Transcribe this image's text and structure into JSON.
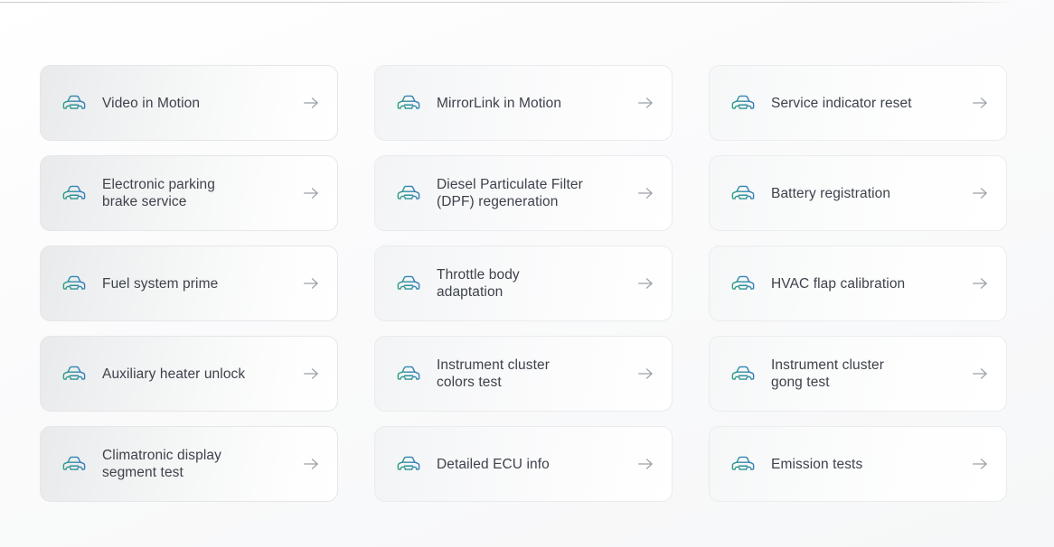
{
  "page": {
    "background_color": "#fbfbfc",
    "divider_color": "#cbced3"
  },
  "theme": {
    "card_border_color": "#e8eaed",
    "label_color": "#3d424b",
    "arrow_color": "#9aa0a6",
    "icon_gradient_start": "#2fa37a",
    "icon_gradient_end": "#3b6fd4"
  },
  "icons": {
    "card_icon": "car-front-icon",
    "card_action": "arrow-right-icon"
  },
  "grid": {
    "columns": 3,
    "rows": 5,
    "cards": [
      {
        "label": "Video in Motion",
        "column": 0,
        "row": 0
      },
      {
        "label": "MirrorLink in Motion",
        "column": 1,
        "row": 0
      },
      {
        "label": "Service indicator reset",
        "column": 2,
        "row": 0
      },
      {
        "label": "Electronic parking\nbrake service",
        "column": 0,
        "row": 1
      },
      {
        "label": "Diesel Particulate Filter\n(DPF) regeneration",
        "column": 1,
        "row": 1
      },
      {
        "label": "Battery registration",
        "column": 2,
        "row": 1
      },
      {
        "label": "Fuel system prime",
        "column": 0,
        "row": 2
      },
      {
        "label": "Throttle body\nadaptation",
        "column": 1,
        "row": 2
      },
      {
        "label": "HVAC flap calibration",
        "column": 2,
        "row": 2
      },
      {
        "label": "Auxiliary heater unlock",
        "column": 0,
        "row": 3
      },
      {
        "label": "Instrument cluster\ncolors test",
        "column": 1,
        "row": 3
      },
      {
        "label": "Instrument cluster\ngong test",
        "column": 2,
        "row": 3
      },
      {
        "label": "Climatronic display\nsegment test",
        "column": 0,
        "row": 4
      },
      {
        "label": "Detailed ECU info",
        "column": 1,
        "row": 4
      },
      {
        "label": "Emission tests",
        "column": 2,
        "row": 4
      }
    ]
  }
}
